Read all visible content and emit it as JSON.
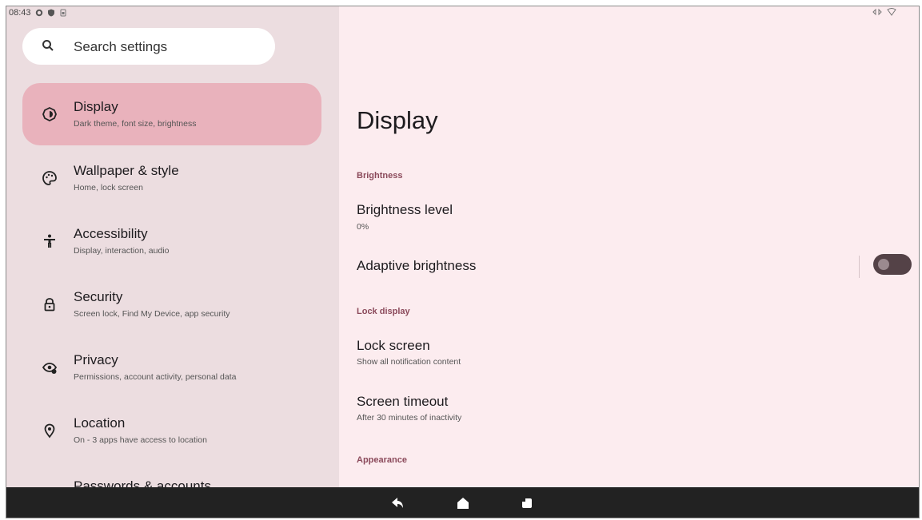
{
  "status_bar": {
    "time": "08:43"
  },
  "search": {
    "label": "Search settings"
  },
  "sidebar": {
    "items": [
      {
        "title": "Display",
        "subtitle": "Dark theme, font size, brightness",
        "icon": "brightness-icon",
        "selected": true
      },
      {
        "title": "Wallpaper & style",
        "subtitle": "Home, lock screen",
        "icon": "palette-icon"
      },
      {
        "title": "Accessibility",
        "subtitle": "Display, interaction, audio",
        "icon": "accessibility-icon"
      },
      {
        "title": "Security",
        "subtitle": "Screen lock, Find My Device, app security",
        "icon": "lock-icon"
      },
      {
        "title": "Privacy",
        "subtitle": "Permissions, account activity, personal data",
        "icon": "privacy-eye-icon"
      },
      {
        "title": "Location",
        "subtitle": "On - 3 apps have access to location",
        "icon": "location-pin-icon"
      },
      {
        "title": "Passwords & accounts",
        "subtitle": "",
        "icon": "key-icon"
      }
    ]
  },
  "main": {
    "title": "Display",
    "brightness_header": "Brightness",
    "brightness_level": {
      "title": "Brightness level",
      "value": "0%"
    },
    "adaptive_brightness": {
      "title": "Adaptive brightness",
      "enabled": false
    },
    "lock_display_header": "Lock display",
    "lock_screen": {
      "title": "Lock screen",
      "subtitle": "Show all notification content"
    },
    "screen_timeout": {
      "title": "Screen timeout",
      "subtitle": "After 30 minutes of inactivity"
    },
    "appearance_header": "Appearance"
  },
  "colors": {
    "accent": "#e9b2bc",
    "section_header": "#8b4a5b",
    "panel_left": "#ecdde0",
    "panel_right": "#fcecef",
    "navbar": "#222222"
  }
}
